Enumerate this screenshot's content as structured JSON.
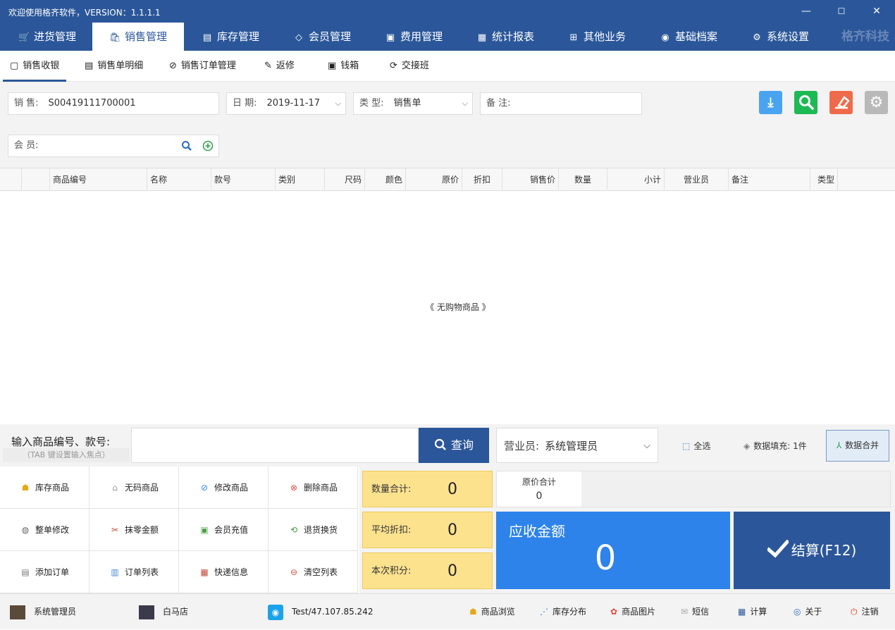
{
  "titlebar": {
    "title": "欢迎使用格齐软件，VERSION：1.1.1.1",
    "min": "—",
    "max": "☐",
    "close": "✕"
  },
  "main_nav": [
    {
      "label": "进货管理",
      "icon": "cart-icon",
      "glyph": "🛒"
    },
    {
      "label": "销售管理",
      "icon": "bag-icon",
      "glyph": "🛍"
    },
    {
      "label": "库存管理",
      "icon": "warehouse-icon",
      "glyph": "▤"
    },
    {
      "label": "会员管理",
      "icon": "diamond-icon",
      "glyph": "◇"
    },
    {
      "label": "费用管理",
      "icon": "money-icon",
      "glyph": "▣"
    },
    {
      "label": "统计报表",
      "icon": "report-icon",
      "glyph": "▦"
    },
    {
      "label": "其他业务",
      "icon": "grid-icon",
      "glyph": "⊞"
    },
    {
      "label": "基础档案",
      "icon": "location-icon",
      "glyph": "◉"
    },
    {
      "label": "系统设置",
      "icon": "gear-icon",
      "glyph": "⚙"
    }
  ],
  "brand": "格齐科技",
  "sub_nav": [
    {
      "label": "销售收银",
      "glyph": "▢"
    },
    {
      "label": "销售单明细",
      "glyph": "▤"
    },
    {
      "label": "销售订单管理",
      "glyph": "⊘"
    },
    {
      "label": "返修",
      "glyph": "✎"
    },
    {
      "label": "钱箱",
      "glyph": "▣"
    },
    {
      "label": "交接班",
      "glyph": "⟳"
    }
  ],
  "form": {
    "sale_label": "销 售:",
    "sale_value": "S00419111700001",
    "date_label": "日 期:",
    "date_value": "2019-11-17",
    "type_label": "类 型:",
    "type_value": "销售单",
    "note_label": "备 注:",
    "note_value": "",
    "member_label": "会 员:",
    "member_value": ""
  },
  "toolbar": {
    "download_color": "#4aa3f0",
    "search_color": "#1db954",
    "erase_color": "#ef6a4a",
    "settings_color": "#b9b9b9"
  },
  "grid": {
    "columns": [
      "商品编号",
      "名称",
      "款号",
      "类别",
      "尺码",
      "颜色",
      "原价",
      "折扣",
      "销售价",
      "数量",
      "小计",
      "营业员",
      "备注",
      "类型"
    ],
    "empty_text": "《 无购物商品 》"
  },
  "input_bar": {
    "label": "输入商品编号、款号:",
    "hint": "（TAB 键设置输入焦点）",
    "input_value": "",
    "query_button": "查询",
    "clerk_label": "营业员:",
    "clerk_value": "系统管理员",
    "select_all": "全选",
    "fill_label": "数据填充:",
    "fill_value": "1件",
    "merge": "数据合并"
  },
  "actions": [
    {
      "label": "库存商品",
      "glyph": "☗",
      "color": "#e6a817"
    },
    {
      "label": "无码商品",
      "glyph": "⌂",
      "color": "#999"
    },
    {
      "label": "修改商品",
      "glyph": "⊘",
      "color": "#2b8ae0"
    },
    {
      "label": "删除商品",
      "glyph": "⊗",
      "color": "#e04a3a"
    },
    {
      "label": "整单修改",
      "glyph": "◍",
      "color": "#666"
    },
    {
      "label": "抹零金额",
      "glyph": "✂",
      "color": "#d04a2a"
    },
    {
      "label": "会员充值",
      "glyph": "▣",
      "color": "#4aa04a"
    },
    {
      "label": "退货换货",
      "glyph": "⟲",
      "color": "#3a9a3a"
    },
    {
      "label": "添加订单",
      "glyph": "▤",
      "color": "#777"
    },
    {
      "label": "订单列表",
      "glyph": "▥",
      "color": "#4a8ad0"
    },
    {
      "label": "快递信息",
      "glyph": "▦",
      "color": "#c04a3a"
    },
    {
      "label": "清空列表",
      "glyph": "⊖",
      "color": "#e04a3a"
    }
  ],
  "summary": {
    "qty_label": "数量合计:",
    "qty_value": "0",
    "discount_label": "平均折扣:",
    "discount_value": "0",
    "points_label": "本次积分:",
    "points_value": "0",
    "orig_label": "原价合计",
    "orig_value": "0",
    "due_label": "应收金额",
    "due_value": "0",
    "checkout": "结算(F12)"
  },
  "status": {
    "user": "系统管理员",
    "store": "白马店",
    "server": "Test/47.107.85.242",
    "browse": "商品浏览",
    "distribution": "库存分布",
    "images": "商品图片",
    "sms": "短信",
    "calc": "计算",
    "about": "关于",
    "logout": "注销"
  }
}
